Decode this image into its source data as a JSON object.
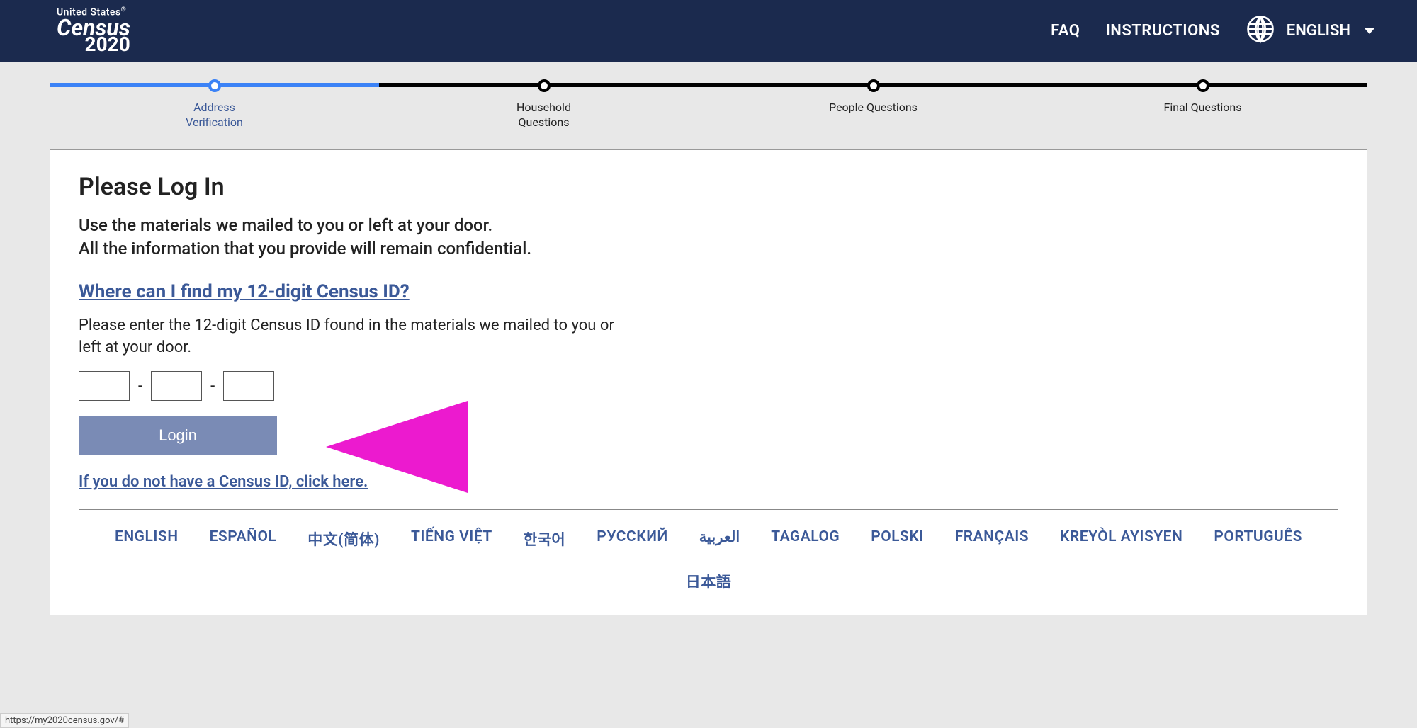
{
  "header": {
    "logo_top": "United States",
    "logo_registered": "®",
    "logo_main": "Census",
    "logo_year": "2020",
    "nav": {
      "faq": "FAQ",
      "instructions": "INSTRUCTIONS"
    },
    "language_switcher": {
      "current": "ENGLISH"
    }
  },
  "progress": {
    "steps": [
      {
        "label_line1": "Address",
        "label_line2": "Verification",
        "active": true
      },
      {
        "label_line1": "Household",
        "label_line2": "Questions",
        "active": false
      },
      {
        "label_line1": "People Questions",
        "label_line2": "",
        "active": false
      },
      {
        "label_line1": "Final Questions",
        "label_line2": "",
        "active": false
      }
    ]
  },
  "main": {
    "title": "Please Log In",
    "subtitle_line1": "Use the materials we mailed to you or left at your door.",
    "subtitle_line2": "All the information that you provide will remain confidential.",
    "help_link": "Where can I find my 12-digit Census ID?",
    "instruction": "Please enter the 12-digit Census ID found in the materials we mailed to you or left at your door.",
    "dash": "-",
    "login_button": "Login",
    "no_id_link": "If you do not have a Census ID, click here."
  },
  "languages": [
    "ENGLISH",
    "ESPAÑOL",
    "中文(简体)",
    "TIẾNG VIỆT",
    "한국어",
    "РУССКИЙ",
    "العربية",
    "TAGALOG",
    "POLSKI",
    "FRANÇAIS",
    "KREYÒL AYISYEN",
    "PORTUGUÊS",
    "日本語"
  ],
  "status_url": "https://my2020census.gov/#"
}
